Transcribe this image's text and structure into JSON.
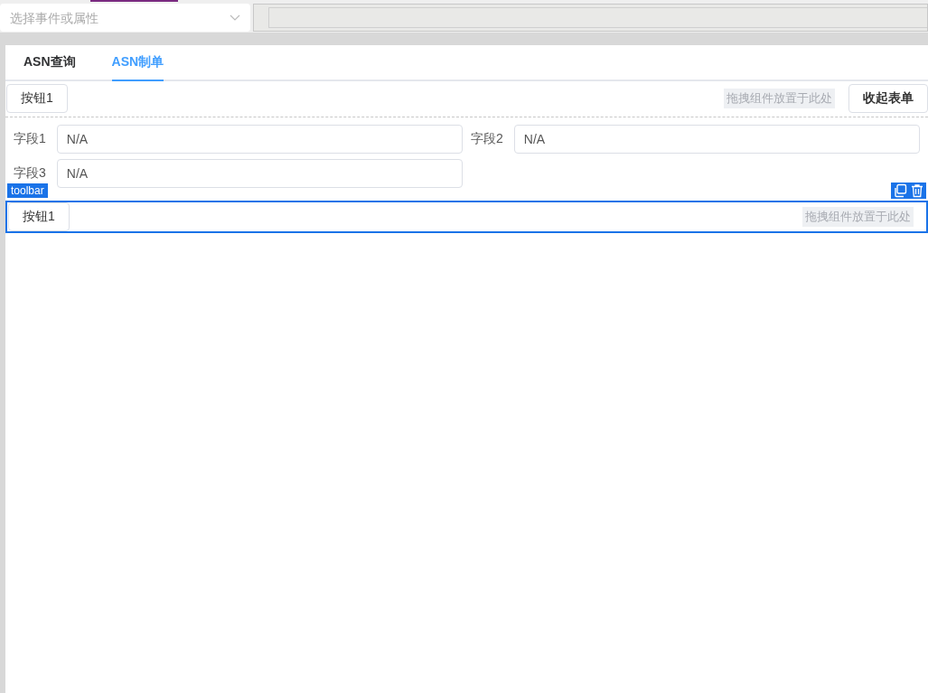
{
  "top_bar": {
    "event_select": {
      "placeholder": "选择事件或属性"
    }
  },
  "tabs": [
    {
      "label": "ASN查询",
      "selected": false
    },
    {
      "label": "ASN制单",
      "selected": true
    }
  ],
  "blocks": [
    {
      "kind": "toolbar",
      "selected": false,
      "buttons": [
        "按钮1"
      ],
      "drop_hint": "拖拽组件放置于此处",
      "collapse_button": "收起表单"
    },
    {
      "kind": "form",
      "fields": [
        {
          "label": "字段1",
          "value": "N/A"
        },
        {
          "label": "字段2",
          "value": "N/A"
        },
        {
          "label": "字段3",
          "value": "N/A"
        }
      ]
    },
    {
      "kind": "toolbar",
      "selected": true,
      "tag": "toolbar",
      "buttons": [
        "按钮1"
      ],
      "drop_hint": "拖拽组件放置于此处"
    }
  ]
}
